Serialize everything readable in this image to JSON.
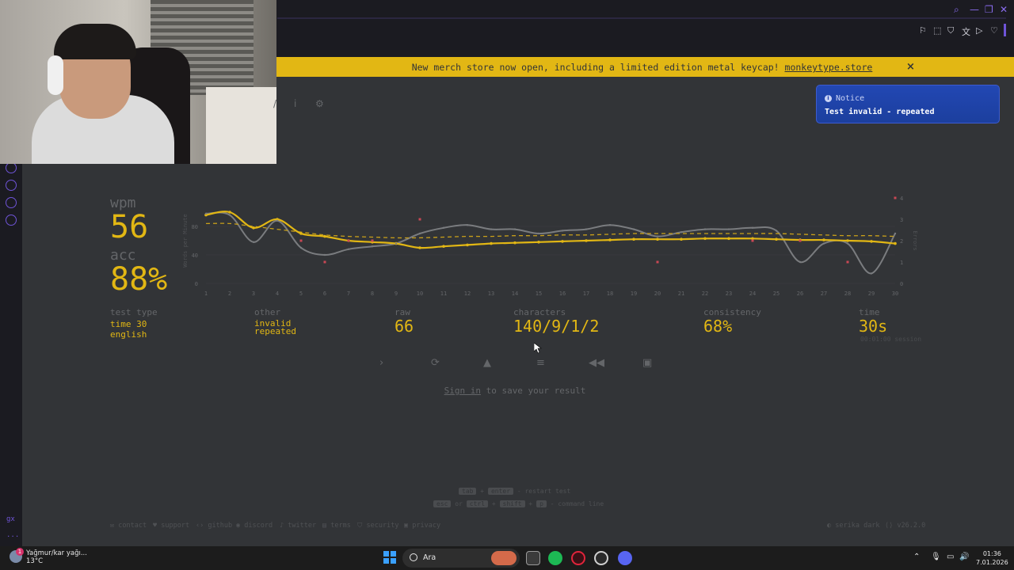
{
  "banner": {
    "text": "New merch store now open, including a limited edition metal keycap! ",
    "link": "monkeytype.store",
    "close_icon": "×"
  },
  "notice": {
    "title": "Notice",
    "message": "Test invalid - repeated"
  },
  "result": {
    "wpm_label": "wpm",
    "wpm_value": "56",
    "acc_label": "acc",
    "acc_value": "88%",
    "test_type_label": "test type",
    "test_type_line1": "time 30",
    "test_type_line2": "english",
    "other_label": "other",
    "other_line1": "invalid",
    "other_line2": "repeated",
    "raw_label": "raw",
    "raw_value": "66",
    "characters_label": "characters",
    "characters_value": "140/9/1/2",
    "consistency_label": "consistency",
    "consistency_value": "68%",
    "time_label": "time",
    "time_value": "30s",
    "session": "00:01:00 session"
  },
  "chart_data": {
    "type": "line",
    "x": [
      1,
      2,
      3,
      4,
      5,
      6,
      7,
      8,
      9,
      10,
      11,
      12,
      13,
      14,
      15,
      16,
      17,
      18,
      19,
      20,
      21,
      22,
      23,
      24,
      25,
      26,
      27,
      28,
      29,
      30
    ],
    "ylabel": "Words per Minute",
    "y2label": "Errors",
    "yticks": [
      0,
      40,
      80
    ],
    "y2ticks": [
      0,
      1,
      2,
      3,
      4
    ],
    "ylim": [
      0,
      120
    ],
    "y2lim": [
      0,
      4
    ],
    "series": [
      {
        "values": [
          96,
          100,
          78,
          90,
          70,
          66,
          60,
          58,
          56,
          50,
          52,
          54,
          56,
          57,
          58,
          59,
          60,
          61,
          62,
          62,
          62,
          63,
          63,
          63,
          62,
          61,
          61,
          60,
          59,
          56
        ]
      },
      {
        "values": [
          98,
          96,
          58,
          88,
          50,
          40,
          48,
          52,
          56,
          70,
          78,
          82,
          76,
          76,
          70,
          74,
          76,
          82,
          76,
          66,
          72,
          76,
          76,
          78,
          74,
          30,
          56,
          56,
          14,
          70
        ]
      },
      {
        "values": [
          84,
          84,
          80,
          76,
          72,
          68,
          66,
          65,
          64,
          64,
          65,
          66,
          66,
          67,
          67,
          68,
          68,
          69,
          70,
          70,
          70,
          70,
          70,
          70,
          70,
          69,
          68,
          67,
          67,
          66
        ]
      }
    ],
    "errors": [
      {
        "x": 5,
        "y": 2
      },
      {
        "x": 6,
        "y": 1
      },
      {
        "x": 7,
        "y": 2
      },
      {
        "x": 8,
        "y": 2
      },
      {
        "x": 10,
        "y": 3
      },
      {
        "x": 20,
        "y": 1
      },
      {
        "x": 24,
        "y": 2
      },
      {
        "x": 26,
        "y": 2
      },
      {
        "x": 28,
        "y": 1
      },
      {
        "x": 30,
        "y": 4
      }
    ],
    "colors": {
      "wpm": "#e2b714",
      "raw": "#7a7c7f",
      "avg": "#c9a01a",
      "error": "#ca4754"
    }
  },
  "signin": {
    "link": "Sign in",
    "text": " to save your result"
  },
  "hints": {
    "key_tab": "tab",
    "plus": "+",
    "key_enter": "enter",
    "restart": "- restart test",
    "key_esc": "esc",
    "or": "or",
    "key_ctrl": "ctrl",
    "key_shift": "shift",
    "key_p": "p",
    "command": "- command line"
  },
  "footer": {
    "contact": "contact",
    "support": "support",
    "github": "github",
    "discord": "discord",
    "twitter": "twitter",
    "terms": "terms",
    "security": "security",
    "privacy": "privacy",
    "theme": "serika dark",
    "version": "v26.2.0"
  },
  "taskbar": {
    "weather_line1": "Yağmur/kar yağı...",
    "weather_line2": "13°C",
    "weather_badge": "1",
    "search": "Ara",
    "time": "01:36",
    "date": "7.01.2026"
  },
  "rail": {
    "gx": "gx",
    "more": "..."
  }
}
